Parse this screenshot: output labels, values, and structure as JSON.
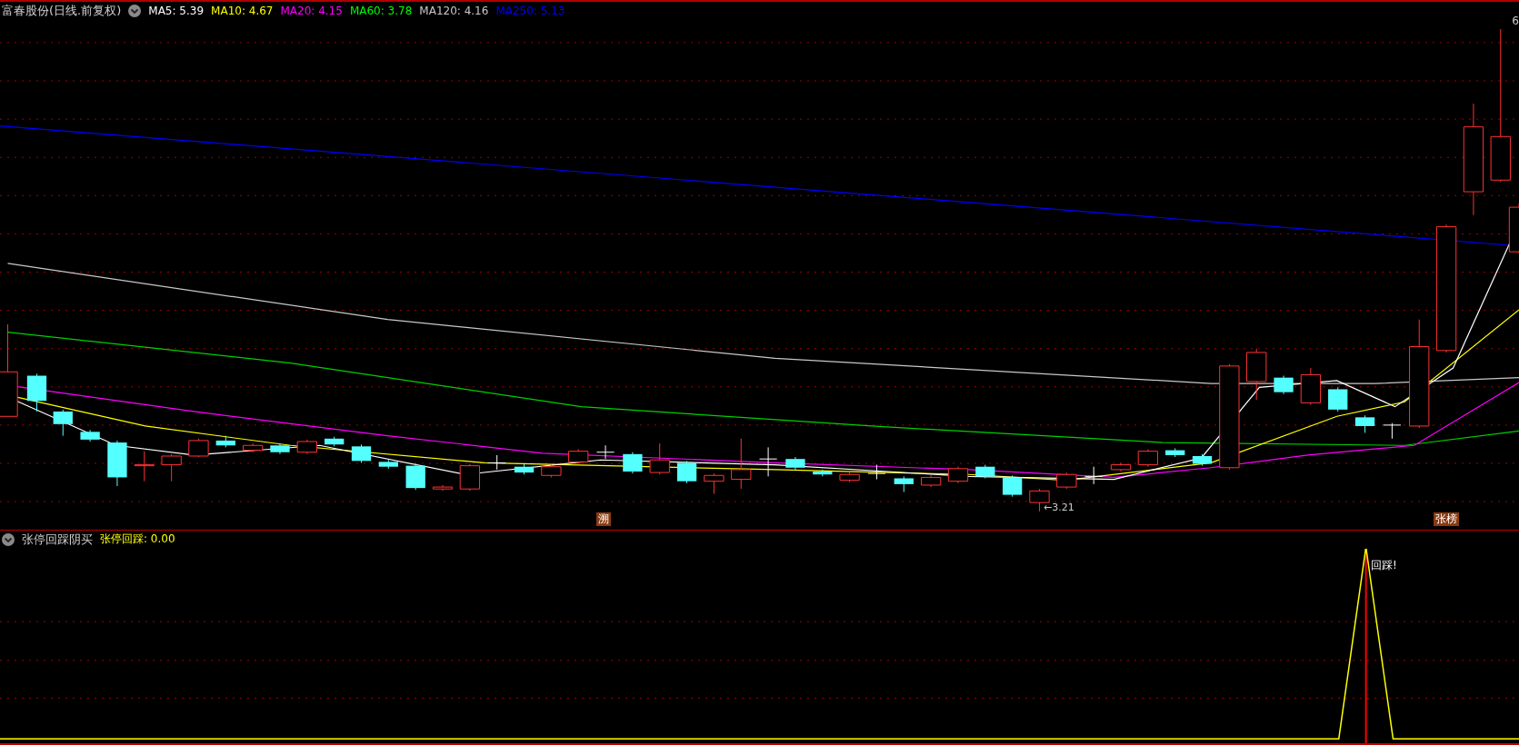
{
  "main_panel": {
    "title": "富春股份(日线.前复权)",
    "legend": [
      {
        "label": "MA5: 5.39",
        "color": "#ffffff"
      },
      {
        "label": "MA10: 4.67",
        "color": "#ffff00"
      },
      {
        "label": "MA20: 4.15",
        "color": "#ff00ff"
      },
      {
        "label": "MA60: 3.78",
        "color": "#00ff00"
      },
      {
        "label": "MA120: 4.16",
        "color": "#c8c8c8"
      },
      {
        "label": "MA250: 5.13",
        "color": "#0000ff"
      }
    ],
    "high_label": "6",
    "low_label": "←3.21",
    "event_tags": [
      {
        "text": "溯",
        "kind": "left"
      },
      {
        "text": "张榜",
        "kind": "right"
      }
    ]
  },
  "indicator_panel": {
    "title": "张停回踩阴买",
    "value_label": "张停回踩: 0.00",
    "signal_label": "回踩!"
  }
}
